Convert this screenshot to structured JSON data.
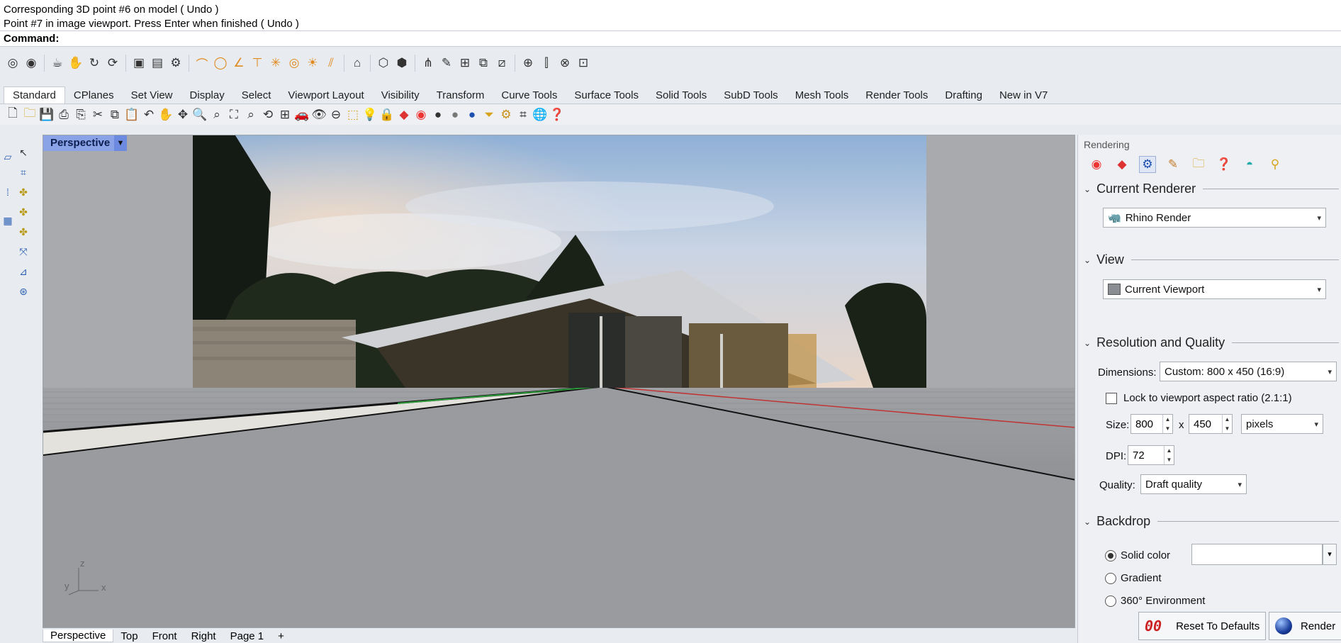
{
  "history": {
    "line1": "Corresponding 3D point #6 on model ( Undo )",
    "line2": "Point #7 in image viewport. Press Enter when finished ( Undo )"
  },
  "command": {
    "label": "Command:",
    "value": ""
  },
  "tabs": [
    "Standard",
    "CPlanes",
    "Set View",
    "Display",
    "Select",
    "Viewport Layout",
    "Visibility",
    "Transform",
    "Curve Tools",
    "Surface Tools",
    "Solid Tools",
    "SubD Tools",
    "Mesh Tools",
    "Render Tools",
    "Drafting",
    "New in V7"
  ],
  "active_tab": "Standard",
  "viewport": {
    "name": "Perspective",
    "axes": {
      "z": "z",
      "y": "y",
      "x": "x"
    }
  },
  "bottom_tabs": [
    "Perspective",
    "Top",
    "Front",
    "Right",
    "Page 1",
    "+"
  ],
  "panel": {
    "title": "Rendering",
    "sections": {
      "renderer": "Current Renderer",
      "view": "View",
      "resolution": "Resolution and Quality",
      "backdrop": "Backdrop"
    },
    "renderer_value": "Rhino Render",
    "view_value": "Current Viewport",
    "dimensions_label": "Dimensions:",
    "dimensions_value": "Custom: 800 x 450 (16:9)",
    "lock_label": "Lock to viewport aspect ratio (2.1:1)",
    "lock_checked": false,
    "size_label": "Size:",
    "width": "800",
    "x_sep": "x",
    "height": "450",
    "units": "pixels",
    "dpi_label": "DPI:",
    "dpi": "72",
    "quality_label": "Quality:",
    "quality_value": "Draft quality",
    "backdrop_options": [
      "Solid color",
      "Gradient",
      "360° Environment"
    ],
    "backdrop_selected": "Solid color",
    "solid_color": "#ffffff"
  },
  "footer": {
    "reset_icon": "00",
    "reset": "Reset To Defaults",
    "render": "Render"
  }
}
